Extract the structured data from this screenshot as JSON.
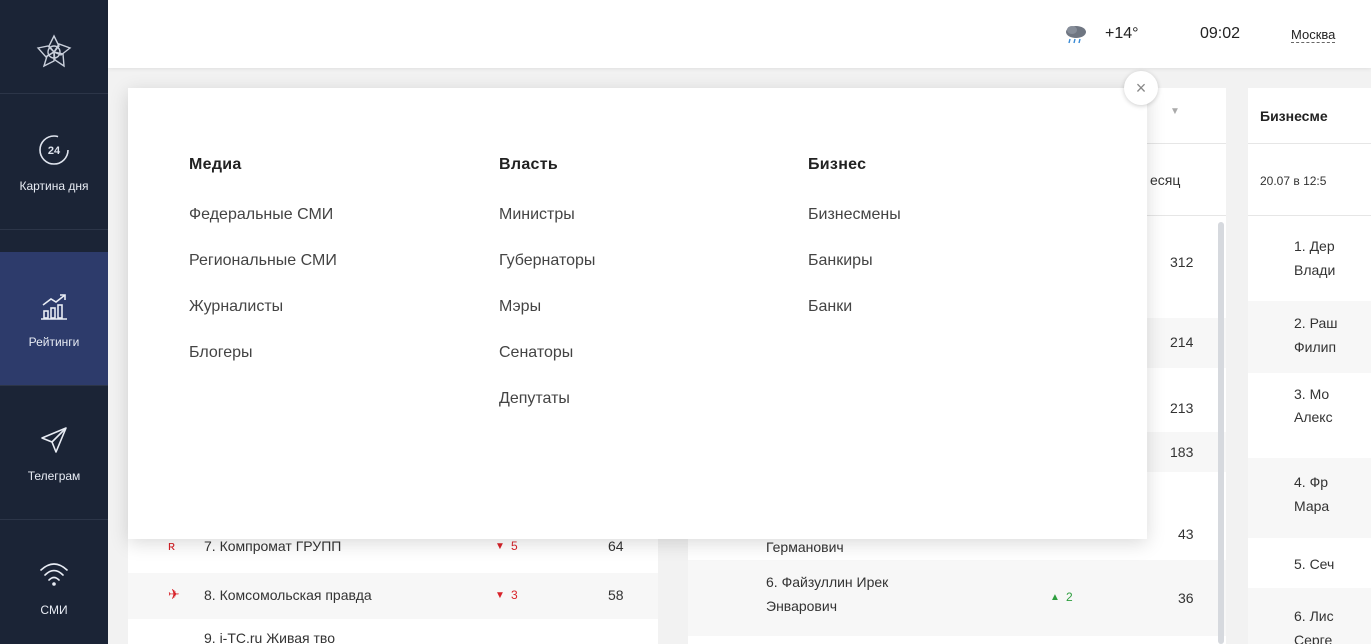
{
  "sidebar": {
    "logo_icon": "flower-logo",
    "items": [
      {
        "label": "Картина дня",
        "icon": "clock-24-icon",
        "active": false
      },
      {
        "label": "Рейтинги",
        "icon": "chart-icon",
        "active": true
      },
      {
        "label": "Телеграм",
        "icon": "paper-plane-icon",
        "active": false
      },
      {
        "label": "СМИ",
        "icon": "wifi-icon",
        "active": false
      }
    ]
  },
  "topbar": {
    "weather_icon": "cloud-rain-icon",
    "temperature": "+14°",
    "time": "09:02",
    "city": "Москва"
  },
  "popup": {
    "columns": [
      {
        "title": "Медиа",
        "links": [
          "Федеральные СМИ",
          "Региональные СМИ",
          "Журналисты",
          "Блогеры"
        ]
      },
      {
        "title": "Власть",
        "links": [
          "Министры",
          "Губернаторы",
          "Мэры",
          "Сенаторы",
          "Депутаты"
        ]
      },
      {
        "title": "Бизнес",
        "links": [
          "Бизнесмены",
          "Банкиры",
          "Банки"
        ]
      }
    ],
    "close_glyph": "×"
  },
  "left_card": {
    "rows": [
      {
        "name": "7. Компромат ГРУПП",
        "change": "5",
        "value": "64"
      },
      {
        "name": "8. Комсомольская правда",
        "change": "3",
        "value": "58"
      },
      {
        "name": "9. i-TC.ru Живая тво"
      }
    ]
  },
  "mid_card": {
    "header_fragment": "есяц",
    "values": [
      "312",
      "214",
      "213",
      "183",
      "43"
    ],
    "partial_name_fragment": "Германович",
    "row6": {
      "name_line1": "6. Файзуллин Ирек",
      "name_line2": "Энварович",
      "change": "2",
      "value": "36"
    }
  },
  "right_card": {
    "title": "Бизнесме",
    "date": "20.07 в 12:5",
    "rows": [
      {
        "line1": "1. Дер",
        "line2": "Влади"
      },
      {
        "line1": "2. Раш",
        "line2": "Филип"
      },
      {
        "line1": "3. Мо",
        "line2": "Алекс"
      },
      {
        "line1": "4. Фр",
        "line2": "Мара"
      },
      {
        "line1": "5. Сеч",
        "line2": ""
      },
      {
        "line1": "6. Лис",
        "line2": "Серге"
      }
    ]
  }
}
